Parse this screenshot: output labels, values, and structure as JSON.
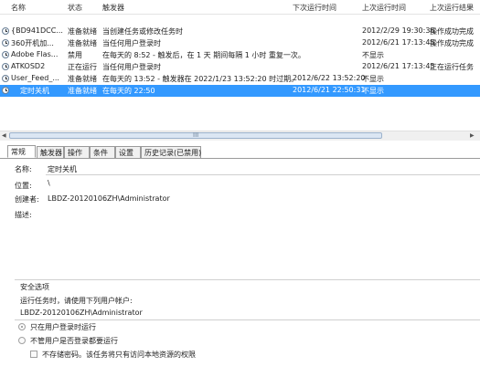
{
  "columns": [
    "名称",
    "状态",
    "触发器",
    "下次运行时间",
    "上次运行时间",
    "上次运行结果"
  ],
  "rows": [
    {
      "name": "{BD941DCC...",
      "status": "准备就绪",
      "trigger": "当创建任务或修改任务时",
      "next": "",
      "last": "2012/2/29 19:30:36",
      "result": "操作成功完成"
    },
    {
      "name": "360开机加...",
      "status": "准备就绪",
      "trigger": "当任何用户登录时",
      "next": "",
      "last": "2012/6/21 17:13:45",
      "result": "操作成功完成"
    },
    {
      "name": "Adobe Flas...",
      "status": "禁用",
      "trigger": "在每天的 8:52 - 触发后，在 1 天 期间每隔 1 小时 重复一次。",
      "next": "",
      "last": "不显示",
      "result": ""
    },
    {
      "name": "ATKOSD2",
      "status": "正在运行",
      "trigger": "当任何用户登录时",
      "next": "",
      "last": "2012/6/21 17:13:45",
      "result": "正在运行任务"
    },
    {
      "name": "User_Feed_...",
      "status": "准备就绪",
      "trigger": "在每天的 13:52 - 触发器在 2022/1/23 13:52:20 时过期。",
      "next": "2012/6/22 13:52:20",
      "last": "不显示",
      "result": ""
    },
    {
      "name": "定时关机",
      "status": "准备就绪",
      "trigger": "在每天的 22:50",
      "next": "2012/6/21 22:50:31",
      "last": "不显示",
      "result": ""
    }
  ],
  "scroll_grip": "III",
  "tabs": [
    "常规",
    "触发器",
    "操作",
    "条件",
    "设置",
    "历史记录(已禁用)"
  ],
  "active_tab": "常规",
  "general": {
    "name_label": "名称:",
    "name_value": "定时关机",
    "location_label": "位置:",
    "location_value": "\\",
    "author_label": "创建者:",
    "author_value": "LBDZ-20120106ZH\\Administrator",
    "desc_label": "描述:",
    "security_title": "安全选项",
    "run_as_label": "运行任务时，请使用下列用户帐户:",
    "run_as_value": "LBDZ-20120106ZH\\Administrator",
    "radio_logged_on": "只在用户登录时运行",
    "radio_whether": "不管用户是否登录都要运行",
    "check_no_password": "不存储密码。该任务将只有访问本地资源的权限"
  }
}
